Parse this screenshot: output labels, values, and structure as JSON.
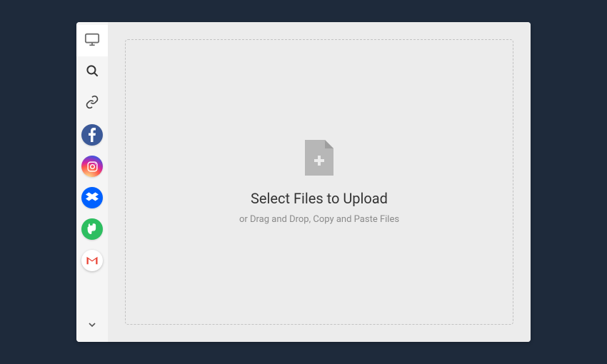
{
  "sidebar": {
    "items": [
      {
        "id": "my-device",
        "icon": "monitor-icon",
        "active": true
      },
      {
        "id": "web-search",
        "icon": "search-icon"
      },
      {
        "id": "link",
        "icon": "link-icon"
      },
      {
        "id": "facebook",
        "icon": "facebook-icon",
        "color": "#3b5998"
      },
      {
        "id": "instagram",
        "icon": "instagram-icon"
      },
      {
        "id": "dropbox",
        "icon": "dropbox-icon",
        "color": "#0061ff"
      },
      {
        "id": "evernote",
        "icon": "evernote-icon",
        "color": "#2dbe60"
      },
      {
        "id": "gmail",
        "icon": "gmail-icon"
      }
    ],
    "more": {
      "icon": "chevron-down-icon"
    }
  },
  "main": {
    "title": "Select Files to Upload",
    "subtitle": "or Drag and Drop, Copy and Paste Files"
  }
}
